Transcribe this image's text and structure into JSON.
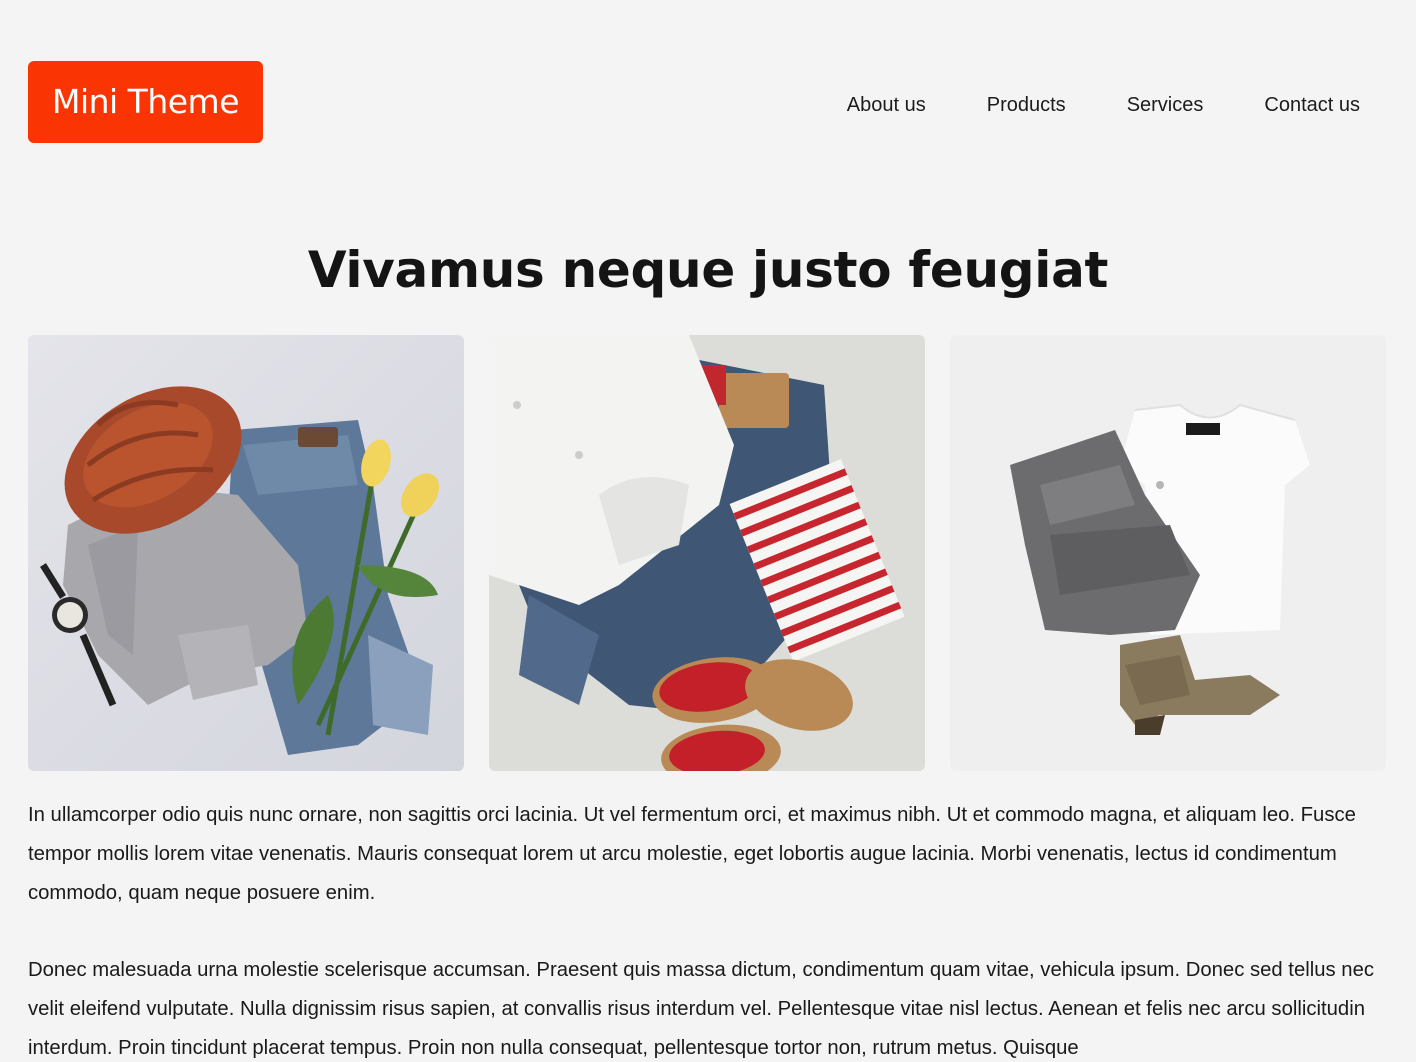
{
  "header": {
    "logo_text": "Mini Theme",
    "nav": [
      "About us",
      "Products",
      "Services",
      "Contact us"
    ]
  },
  "hero": {
    "headline": "Vivamus neque justo feugiat"
  },
  "gallery": {
    "images": [
      {
        "subject": "knit-hat-sweater-jeans-tulips-watch"
      },
      {
        "subject": "white-shirt-jeans-striped-top-red-sandals"
      },
      {
        "subject": "grey-jeans-white-tshirt-suede-boot"
      }
    ]
  },
  "body": {
    "paragraphs": [
      "In ullamcorper odio quis nunc ornare, non sagittis orci lacinia. Ut vel fermentum orci, et maximus nibh. Ut et commodo magna, et aliquam leo. Fusce tempor mollis lorem vitae venenatis. Mauris consequat lorem ut arcu molestie, eget lobortis augue lacinia. Morbi venenatis, lectus id condimentum commodo, quam neque posuere enim.",
      "Donec malesuada urna molestie scelerisque accumsan. Praesent quis massa dictum, condimentum quam vitae, vehicula ipsum. Donec sed tellus nec velit eleifend vulputate. Nulla dignissim risus sapien, at convallis risus interdum vel. Pellentesque vitae nisl lectus. Aenean et felis nec arcu sollicitudin interdum. Proin tincidunt placerat tempus. Proin non nulla consequat, pellentesque tortor non, rutrum metus. Quisque"
    ]
  },
  "colors": {
    "accent": "#fa3503",
    "background": "#f4f4f4",
    "text": "#1a1a1a"
  }
}
